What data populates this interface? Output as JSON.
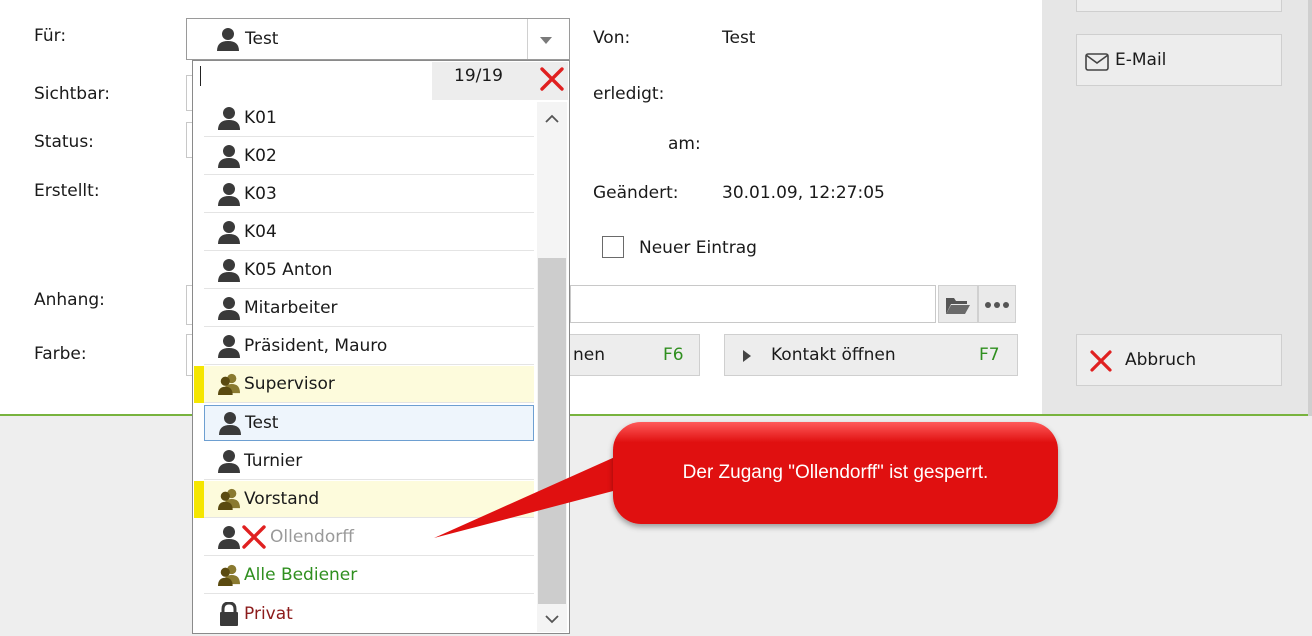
{
  "form": {
    "fuer_label": "Für:",
    "fuer_value": "Test",
    "sichtbar_label": "Sichtbar:",
    "status_label": "Status:",
    "erstellt_label": "Erstellt:",
    "anhang_label": "Anhang:",
    "farbe_label": "Farbe:",
    "von_label": "Von:",
    "von_value": "Test",
    "erledigt_label": "erledigt:",
    "am_label": "am:",
    "geaendert_label": "Geändert:",
    "geaendert_value": "30.01.09, 12:27:05",
    "neuer_eintrag_label": "Neuer Eintrag",
    "btn_partial_label": "nen",
    "btn_partial_key": "F6",
    "kontakt_label": "Kontakt öffnen",
    "kontakt_key": "F7"
  },
  "dropdown": {
    "search_value": "",
    "counter": "19/19",
    "items": [
      {
        "label": "K01",
        "type": "user"
      },
      {
        "label": "K02",
        "type": "user"
      },
      {
        "label": "K03",
        "type": "user"
      },
      {
        "label": "K04",
        "type": "user"
      },
      {
        "label": "K05 Anton",
        "type": "user"
      },
      {
        "label": "Mitarbeiter",
        "type": "user"
      },
      {
        "label": "Präsident, Mauro",
        "type": "user"
      },
      {
        "label": "Supervisor",
        "type": "group"
      },
      {
        "label": "Test",
        "type": "user",
        "selected": true
      },
      {
        "label": "Turnier",
        "type": "user"
      },
      {
        "label": "Vorstand",
        "type": "group"
      },
      {
        "label": "Ollendorff",
        "type": "disabled"
      },
      {
        "label": "Alle Bediener",
        "type": "all"
      },
      {
        "label": "Privat",
        "type": "private"
      }
    ]
  },
  "side": {
    "email_label": "E-Mail",
    "abbruch_label": "Abbruch"
  },
  "callout": {
    "text": "Der Zugang \"Ollendorff\" ist gesperrt."
  },
  "colors": {
    "accent_green": "#78b33e",
    "callout_red": "#e01010",
    "group_yellow": "#f5e600",
    "close_red": "#e02020"
  }
}
